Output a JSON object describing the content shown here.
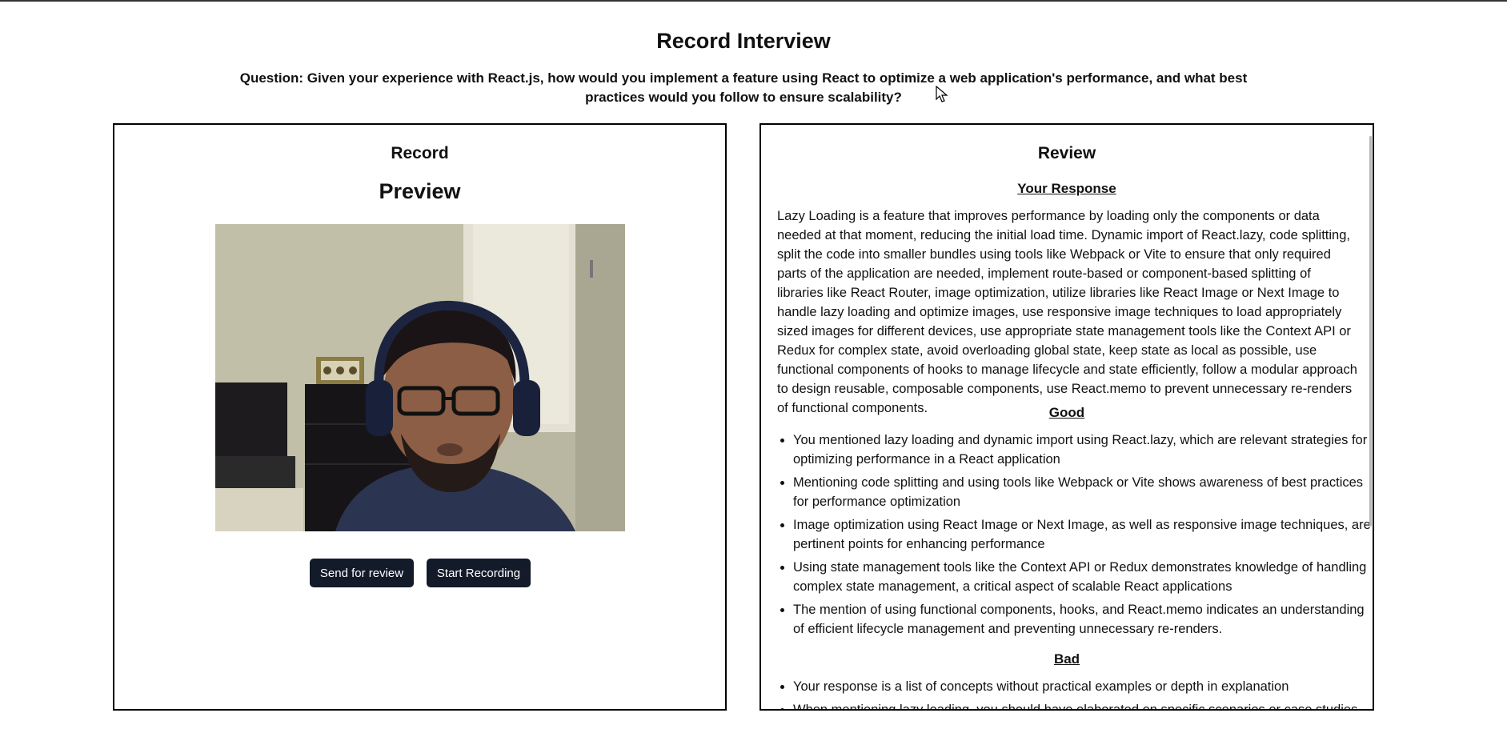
{
  "page": {
    "title": "Record Interview",
    "question": "Question: Given your experience with React.js, how would you implement a feature using React to optimize a web application's performance, and what best practices would you follow to ensure scalability?"
  },
  "record": {
    "heading": "Record",
    "preview_heading": "Preview",
    "send_button": "Send for review",
    "start_button": "Start Recording"
  },
  "review": {
    "heading": "Review",
    "response_title": "Your Response",
    "response_text": "Lazy Loading is a feature that improves performance by loading only the components or data needed at that moment, reducing the initial load time. Dynamic import of React.lazy, code splitting, split the code into smaller bundles using tools like Webpack or Vite to ensure that only required parts of the application are needed, implement route-based or component-based splitting of libraries like React Router, image optimization, utilize libraries like React Image or Next Image to handle lazy loading and optimize images, use responsive image techniques to load appropriately sized images for different devices, use appropriate state management tools like the Context API or Redux for complex state, avoid overloading global state, keep state as local as possible, use functional components of hooks to manage lifecycle and state efficiently, follow a modular approach to design reusable, composable components, use React.memo to prevent unnecessary re-renders of functional components.",
    "good_title": "Good",
    "good_items": [
      "You mentioned lazy loading and dynamic import using React.lazy, which are relevant strategies for optimizing performance in a React application",
      "Mentioning code splitting and using tools like Webpack or Vite shows awareness of best practices for performance optimization",
      "Image optimization using React Image or Next Image, as well as responsive image techniques, are pertinent points for enhancing performance",
      "Using state management tools like the Context API or Redux demonstrates knowledge of handling complex state management, a critical aspect of scalable React applications",
      "The mention of using functional components, hooks, and React.memo indicates an understanding of efficient lifecycle management and preventing unnecessary re-renders."
    ],
    "bad_title": "Bad",
    "bad_items": [
      "Your response is a list of concepts without practical examples or depth in explanation",
      "When mentioning lazy loading, you should have elaborated on specific scenarios or case studies"
    ]
  },
  "icons": {
    "cursor": "mouse-pointer-icon"
  }
}
